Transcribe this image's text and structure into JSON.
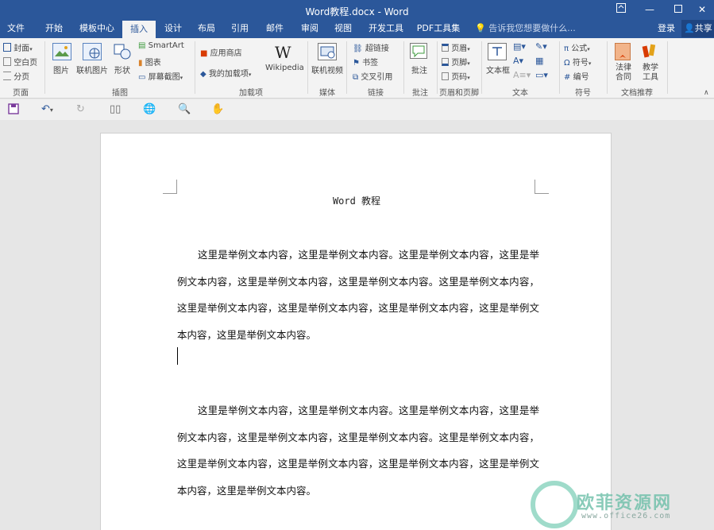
{
  "window": {
    "title": "Word教程.docx - Word",
    "controls": [
      "restore-ribbon",
      "minimize",
      "maximize",
      "close"
    ]
  },
  "tabs": [
    "文件",
    "开始",
    "模板中心",
    "插入",
    "设计",
    "布局",
    "引用",
    "邮件",
    "审阅",
    "视图",
    "开发工具",
    "PDF工具集"
  ],
  "active_tab": "插入",
  "tell_me": "告诉我您想要做什么...",
  "account": {
    "login": "登录",
    "share": "共享"
  },
  "ribbon": {
    "pages": {
      "cover": "封面",
      "blank": "空白页",
      "break": "分页",
      "group": "页面"
    },
    "illustrations": {
      "picture": "图片",
      "online_picture": "联机图片",
      "shapes": "形状",
      "smartart": "SmartArt",
      "chart": "图表",
      "screenshot": "屏幕截图",
      "group": "插图"
    },
    "addins": {
      "store": "应用商店",
      "my_addins": "我的加载项",
      "wikipedia": "Wikipedia",
      "group": "加载项"
    },
    "media": {
      "online_video": "联机视频",
      "group": "媒体"
    },
    "links": {
      "hyperlink": "超链接",
      "bookmark": "书签",
      "cross_ref": "交叉引用",
      "group": "链接"
    },
    "comments": {
      "comment": "批注",
      "group": "批注"
    },
    "header_footer": {
      "header": "页眉",
      "footer": "页脚",
      "page_number": "页码",
      "group": "页眉和页脚"
    },
    "text": {
      "textbox": "文本框",
      "group": "文本"
    },
    "symbols": {
      "equation": "公式",
      "symbol": "符号",
      "number": "编号",
      "group": "符号"
    },
    "recommend": {
      "legal": "法律合同",
      "teaching": "教学工具",
      "group": "文档推荐"
    }
  },
  "document": {
    "heading": "Word 教程",
    "paragraph1": "这里是举例文本内容，这里是举例文本内容。这里是举例文本内容，这里是举例文本内容，这里是举例文本内容，这里是举例文本内容。这里是举例文本内容，这里是举例文本内容，这里是举例文本内容，这里是举例文本内容，这里是举例文本内容，这里是举例文本内容。",
    "paragraph2": "这里是举例文本内容，这里是举例文本内容。这里是举例文本内容，这里是举例文本内容，这里是举例文本内容，这里是举例文本内容。这里是举例文本内容，这里是举例文本内容，这里是举例文本内容，这里是举例文本内容，这里是举例文本内容，这里是举例文本内容。"
  },
  "watermark": {
    "text": "欧菲资源网",
    "url": "www.office26.com"
  },
  "colors": {
    "accent": "#2b579a",
    "ribbon_bg": "#f3f3f3",
    "workspace": "#e6e6e6"
  }
}
